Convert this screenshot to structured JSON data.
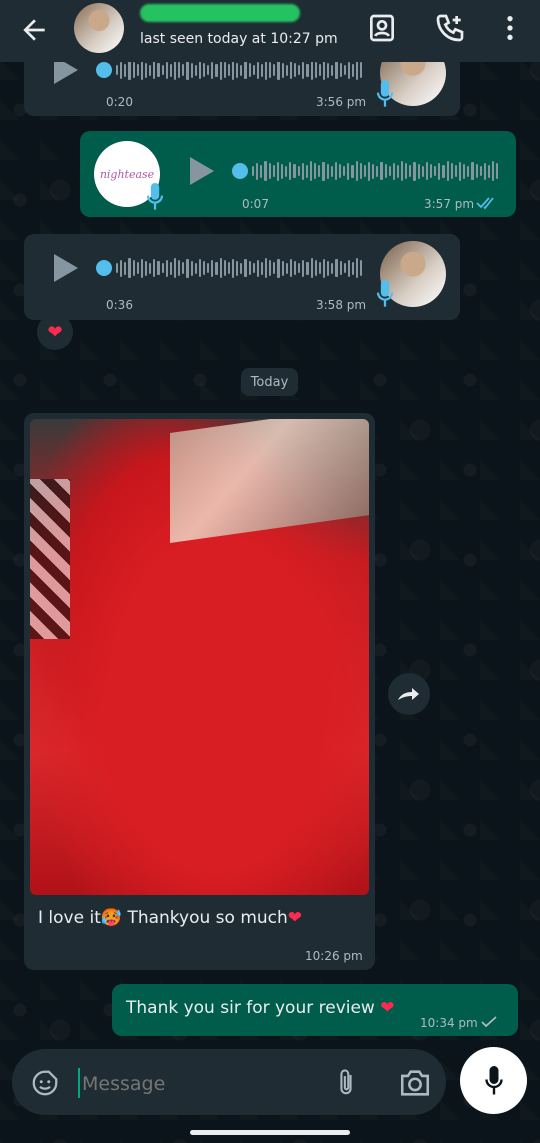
{
  "header": {
    "status": "last seen today at 10:27 pm",
    "icons": [
      "back-arrow-icon",
      "contact-card-icon",
      "add-call-icon",
      "more-vert-icon"
    ]
  },
  "messages": [
    {
      "type": "voice",
      "direction": "in",
      "duration": "0:20",
      "time": "3:56 pm"
    },
    {
      "type": "voice",
      "direction": "out",
      "duration": "0:07",
      "time": "3:57 pm",
      "status": "read",
      "logo_text": "nightease"
    },
    {
      "type": "voice",
      "direction": "in",
      "duration": "0:36",
      "time": "3:58 pm",
      "reaction": "❤"
    },
    {
      "type": "date",
      "label": "Today"
    },
    {
      "type": "image",
      "direction": "in",
      "caption_start": "I love it",
      "caption_emoji": "🥵",
      "caption_end": "Thankyou so much",
      "caption_heart": "❤",
      "time": "10:26 pm"
    },
    {
      "type": "text",
      "direction": "out",
      "text": "Thank you sir for your review",
      "heart": "❤",
      "time": "10:34 pm",
      "status": "sent"
    }
  ],
  "composer": {
    "placeholder": "Message",
    "icons": [
      "sticker-icon",
      "attach-icon",
      "camera-icon",
      "mic-icon"
    ]
  },
  "colors": {
    "background": "#0b141a",
    "incoming": "#1f2c34",
    "outgoing": "#005c4b",
    "accent": "#53bdeb",
    "green": "#25d366"
  }
}
